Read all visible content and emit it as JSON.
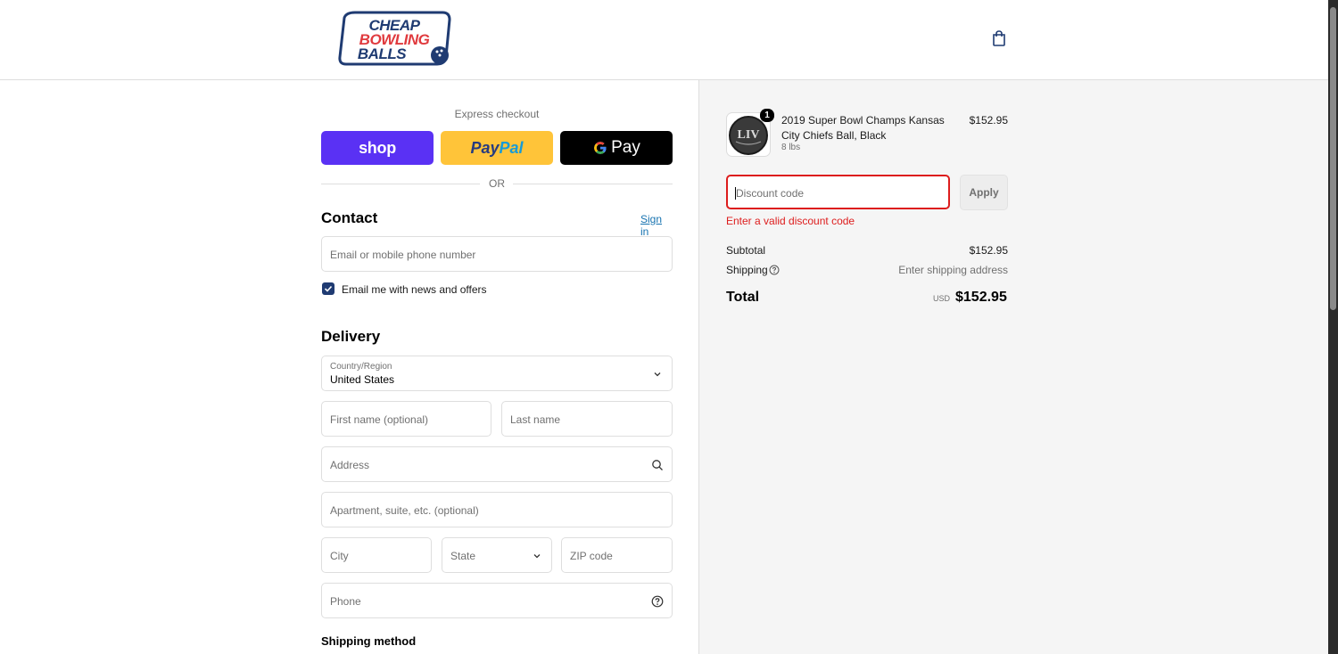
{
  "header": {
    "logo_lines": [
      "CHEAP",
      "BOWLING",
      "BALLS"
    ],
    "cart_icon": "shopping-bag-icon"
  },
  "express": {
    "label": "Express checkout",
    "shop_label": "shop",
    "paypal_label_1": "Pay",
    "paypal_label_2": "Pal",
    "gpay_label": "Pay",
    "or_label": "OR"
  },
  "contact": {
    "title": "Contact",
    "sign_in": "Sign in",
    "email_placeholder": "Email or mobile phone number",
    "newsletter_label": "Email me with news and offers",
    "newsletter_checked": true
  },
  "delivery": {
    "title": "Delivery",
    "country_label": "Country/Region",
    "country_value": "United States",
    "first_name_placeholder": "First name (optional)",
    "last_name_placeholder": "Last name",
    "address_placeholder": "Address",
    "apartment_placeholder": "Apartment, suite, etc. (optional)",
    "city_placeholder": "City",
    "state_placeholder": "State",
    "zip_placeholder": "ZIP code",
    "phone_placeholder": "Phone"
  },
  "shipping_method": {
    "title": "Shipping method"
  },
  "summary": {
    "product": {
      "quantity": "1",
      "name": "2019 Super Bowl Champs Kansas City Chiefs Ball, Black",
      "variant": "8 lbs",
      "price": "$152.95",
      "thumb_text": "LIV"
    },
    "discount_placeholder": "Discount code",
    "apply_label": "Apply",
    "error": "Enter a valid discount code",
    "subtotal_label": "Subtotal",
    "subtotal_value": "$152.95",
    "shipping_label": "Shipping",
    "shipping_value": "Enter shipping address",
    "total_label": "Total",
    "currency": "USD",
    "total_value": "$152.95"
  },
  "colors": {
    "shop": "#5a31f4",
    "paypal": "#ffc439",
    "error": "#dd1d1d",
    "link": "#1773b0",
    "checkbox": "#1f3b72"
  }
}
